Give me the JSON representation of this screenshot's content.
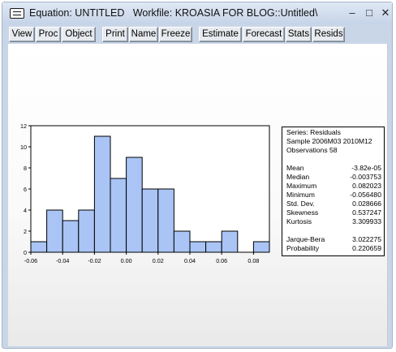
{
  "window": {
    "title": "Equation: UNTITLED   Workfile: KROASIA FOR BLOG::Untitled\\",
    "minimize_glyph": "–",
    "maximize_glyph": "□",
    "close_glyph": "✕"
  },
  "toolbar": {
    "buttons": [
      "View",
      "Proc",
      "Object",
      "Print",
      "Name",
      "Freeze",
      "Estimate",
      "Forecast",
      "Stats",
      "Resids"
    ]
  },
  "stats": {
    "series": "Series: Residuals",
    "sample": "Sample 2006M03 2010M12",
    "observations": "Observations 58",
    "rows": [
      {
        "label": "Mean",
        "value": "-3.82e-05"
      },
      {
        "label": "Median",
        "value": "-0.003753"
      },
      {
        "label": "Maximum",
        "value": "0.082023"
      },
      {
        "label": "Minimum",
        "value": "-0.056480"
      },
      {
        "label": "Std. Dev.",
        "value": "0.028666"
      },
      {
        "label": "Skewness",
        "value": "0.537247"
      },
      {
        "label": "Kurtosis",
        "value": "3.309933"
      },
      {
        "label": "Jarque-Bera",
        "value": "3.022275"
      },
      {
        "label": "Probability",
        "value": "0.220659"
      }
    ]
  },
  "chart_data": {
    "type": "bar",
    "title": "",
    "bin_width": 0.01,
    "bin_edges": [
      -0.06,
      -0.05,
      -0.04,
      -0.03,
      -0.02,
      -0.01,
      0.0,
      0.01,
      0.02,
      0.03,
      0.04,
      0.05,
      0.06,
      0.07,
      0.08,
      0.09
    ],
    "values": [
      1,
      4,
      3,
      4,
      11,
      7,
      9,
      6,
      6,
      2,
      1,
      1,
      2,
      0,
      1
    ],
    "xlim": [
      -0.06,
      0.09
    ],
    "ylim": [
      0,
      12
    ],
    "x_ticks": [
      "-0.06",
      "-0.04",
      "-0.02",
      "0.00",
      "0.02",
      "0.04",
      "0.06",
      "0.08"
    ],
    "x_tick_values": [
      -0.06,
      -0.04,
      -0.02,
      0.0,
      0.02,
      0.04,
      0.06,
      0.08
    ],
    "y_ticks": [
      "0",
      "2",
      "4",
      "6",
      "8",
      "10",
      "12"
    ],
    "y_tick_values": [
      0,
      2,
      4,
      6,
      8,
      10,
      12
    ],
    "bar_color": "#a9c4f5",
    "edge_color": "#000000",
    "grid": false
  }
}
